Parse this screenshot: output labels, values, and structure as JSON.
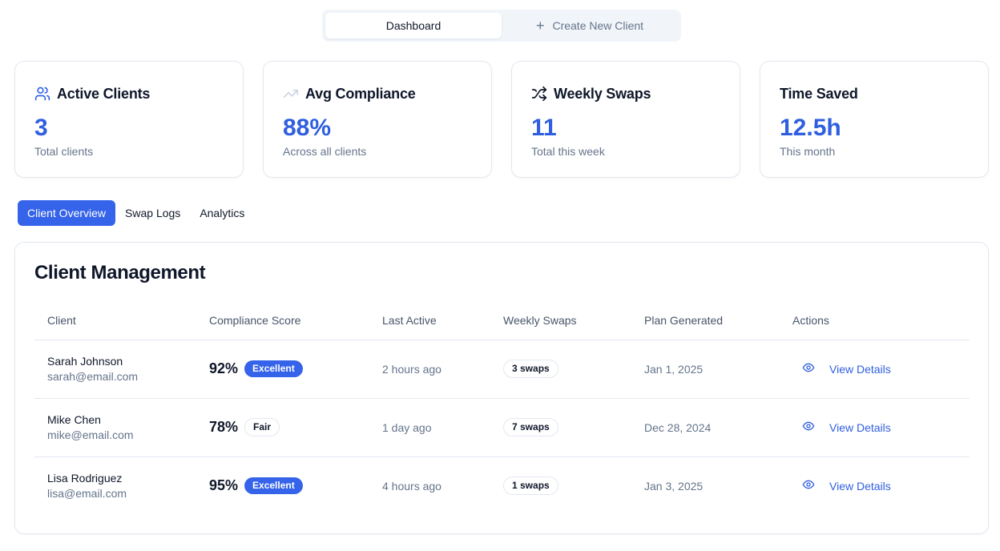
{
  "nav": {
    "dashboard": "Dashboard",
    "create_client": "Create New Client"
  },
  "stats": [
    {
      "icon": "users-icon",
      "title": "Active Clients",
      "value": "3",
      "sub": "Total clients"
    },
    {
      "icon": "trending-up-icon",
      "title": "Avg Compliance",
      "value": "88%",
      "sub": "Across all clients"
    },
    {
      "icon": "shuffle-icon",
      "title": "Weekly Swaps",
      "value": "11",
      "sub": "Total this week"
    },
    {
      "icon": "",
      "title": "Time Saved",
      "value": "12.5h",
      "sub": "This month"
    }
  ],
  "tabs": {
    "overview": "Client Overview",
    "swap_logs": "Swap Logs",
    "analytics": "Analytics"
  },
  "panel": {
    "title": "Client Management",
    "columns": [
      "Client",
      "Compliance Score",
      "Last Active",
      "Weekly Swaps",
      "Plan Generated",
      "Actions"
    ],
    "rows": [
      {
        "name": "Sarah Johnson",
        "email": "sarah@email.com",
        "score": "92%",
        "badge": "Excellent",
        "last_active": "2 hours ago",
        "swaps": "3 swaps",
        "plan": "Jan 1, 2025",
        "action": "View Details"
      },
      {
        "name": "Mike Chen",
        "email": "mike@email.com",
        "score": "78%",
        "badge": "Fair",
        "last_active": "1 day ago",
        "swaps": "7 swaps",
        "plan": "Dec 28, 2024",
        "action": "View Details"
      },
      {
        "name": "Lisa Rodriguez",
        "email": "lisa@email.com",
        "score": "95%",
        "badge": "Excellent",
        "last_active": "4 hours ago",
        "swaps": "1 swaps",
        "plan": "Jan 3, 2025",
        "action": "View Details"
      }
    ]
  },
  "colors": {
    "accent": "#3563e9",
    "accent_text": "#2f5fe0",
    "muted": "#64748b",
    "border": "#e2e8f0"
  }
}
